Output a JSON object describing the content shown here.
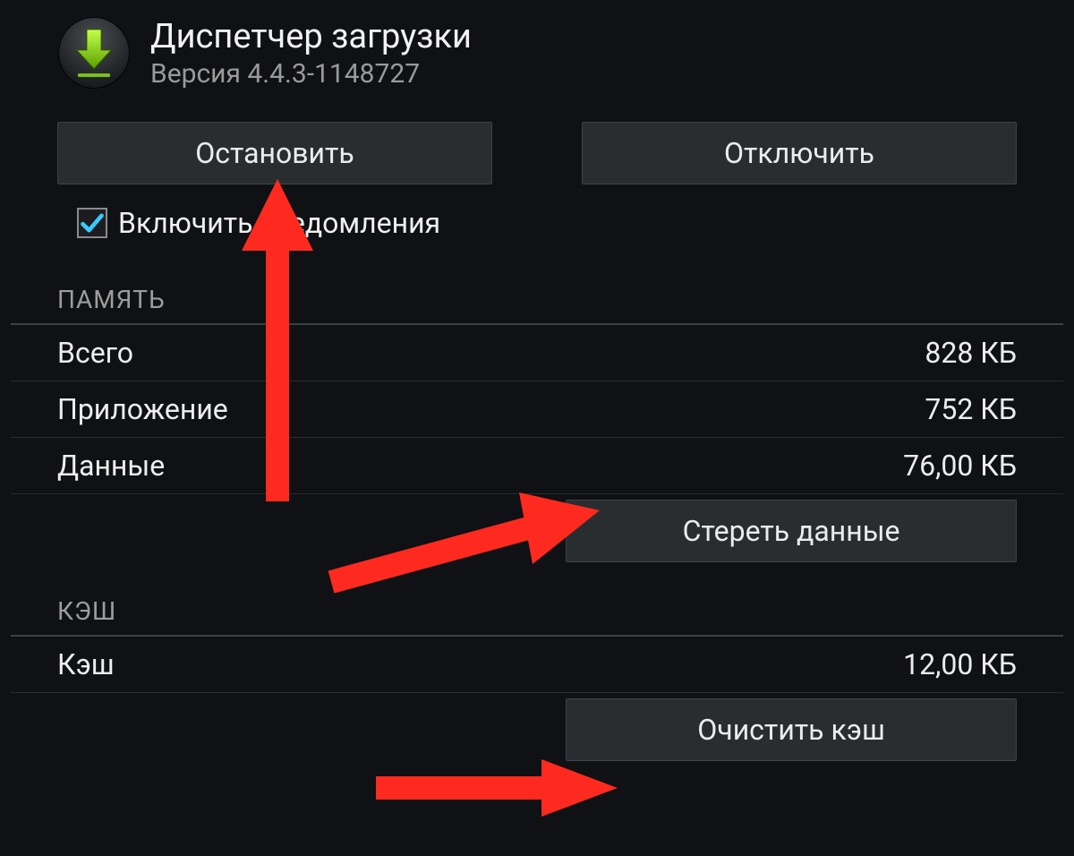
{
  "app": {
    "title": "Диспетчер загрузки",
    "version": "Версия 4.4.3-1148727"
  },
  "buttons": {
    "stop": "Остановить",
    "disable": "Отключить",
    "clear_data": "Стереть данные",
    "clear_cache": "Очистить кэш"
  },
  "checkbox": {
    "notifications_label": "Включить уведомления",
    "checked": true
  },
  "sections": {
    "memory_header": "ПАМЯТЬ",
    "cache_header": "КЭШ"
  },
  "memory": {
    "total_label": "Всего",
    "total_value": "828 КБ",
    "app_label": "Приложение",
    "app_value": "752 КБ",
    "data_label": "Данные",
    "data_value": "76,00 КБ"
  },
  "cache": {
    "label": "Кэш",
    "value": "12,00 КБ"
  },
  "annotations": {
    "color": "#ff2a1f"
  }
}
